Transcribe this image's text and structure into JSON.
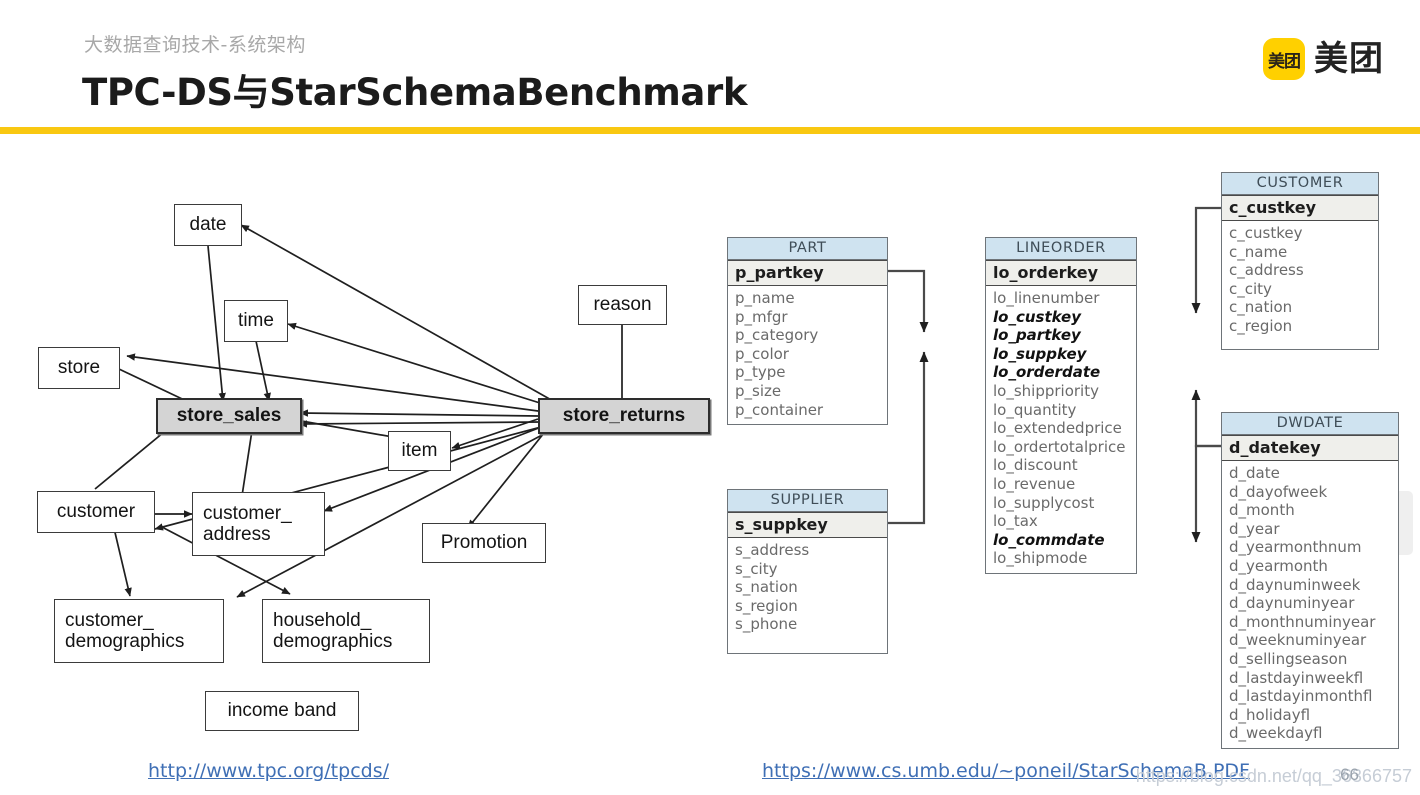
{
  "header": {
    "kicker": "大数据查询技术-系统架构",
    "title": "TPC-DS与StarSchemaBenchmark",
    "logo_badge": "美团",
    "logo_word": "美团",
    "accent_color": "#F9C811"
  },
  "tpcds_diagram": {
    "nodes": [
      {
        "id": "date",
        "label": "date"
      },
      {
        "id": "time",
        "label": "time"
      },
      {
        "id": "store",
        "label": "store"
      },
      {
        "id": "store_sales",
        "label": "store_sales"
      },
      {
        "id": "store_returns",
        "label": "store_returns"
      },
      {
        "id": "reason",
        "label": "reason"
      },
      {
        "id": "item",
        "label": "item"
      },
      {
        "id": "promotion",
        "label": "Promotion"
      },
      {
        "id": "customer",
        "label": "customer"
      },
      {
        "id": "customer_address",
        "label": "customer_\naddress"
      },
      {
        "id": "customer_demographics",
        "label": "customer_\ndemographics"
      },
      {
        "id": "household_demographics",
        "label": "household_\ndemographics"
      },
      {
        "id": "income_band",
        "label": "income band"
      }
    ],
    "fact_tables": [
      "store_sales",
      "store_returns"
    ]
  },
  "ssb_schema": {
    "tables": [
      {
        "name": "PART",
        "key": "p_partkey",
        "columns": [
          {
            "name": "p_name",
            "fk": false
          },
          {
            "name": "p_mfgr",
            "fk": false
          },
          {
            "name": "p_category",
            "fk": false
          },
          {
            "name": "p_color",
            "fk": false
          },
          {
            "name": "p_type",
            "fk": false
          },
          {
            "name": "p_size",
            "fk": false
          },
          {
            "name": "p_container",
            "fk": false
          }
        ]
      },
      {
        "name": "SUPPLIER",
        "key": "s_suppkey",
        "columns": [
          {
            "name": "s_address",
            "fk": false
          },
          {
            "name": "s_city",
            "fk": false
          },
          {
            "name": "s_nation",
            "fk": false
          },
          {
            "name": "s_region",
            "fk": false
          },
          {
            "name": "s_phone",
            "fk": false
          }
        ]
      },
      {
        "name": "LINEORDER",
        "key": "lo_orderkey",
        "columns": [
          {
            "name": "lo_linenumber",
            "fk": false
          },
          {
            "name": "lo_custkey",
            "fk": true
          },
          {
            "name": "lo_partkey",
            "fk": true
          },
          {
            "name": "lo_suppkey",
            "fk": true
          },
          {
            "name": "lo_orderdate",
            "fk": true
          },
          {
            "name": "lo_shippriority",
            "fk": false
          },
          {
            "name": "lo_quantity",
            "fk": false
          },
          {
            "name": "lo_extendedprice",
            "fk": false
          },
          {
            "name": "lo_ordertotalprice",
            "fk": false
          },
          {
            "name": "lo_discount",
            "fk": false
          },
          {
            "name": "lo_revenue",
            "fk": false
          },
          {
            "name": "lo_supplycost",
            "fk": false
          },
          {
            "name": "lo_tax",
            "fk": false
          },
          {
            "name": "lo_commdate",
            "fk": true
          },
          {
            "name": "lo_shipmode",
            "fk": false
          }
        ]
      },
      {
        "name": "CUSTOMER",
        "key": "c_custkey",
        "columns": [
          {
            "name": "c_custkey",
            "fk": false
          },
          {
            "name": "c_name",
            "fk": false
          },
          {
            "name": "c_address",
            "fk": false
          },
          {
            "name": "c_city",
            "fk": false
          },
          {
            "name": "c_nation",
            "fk": false
          },
          {
            "name": "c_region",
            "fk": false
          }
        ]
      },
      {
        "name": "DWDATE",
        "key": "d_datekey",
        "columns": [
          {
            "name": "d_date",
            "fk": false
          },
          {
            "name": "d_dayofweek",
            "fk": false
          },
          {
            "name": "d_month",
            "fk": false
          },
          {
            "name": "d_year",
            "fk": false
          },
          {
            "name": "d_yearmonthnum",
            "fk": false
          },
          {
            "name": "d_yearmonth",
            "fk": false
          },
          {
            "name": "d_daynuminweek",
            "fk": false
          },
          {
            "name": "d_daynuminyear",
            "fk": false
          },
          {
            "name": "d_monthnuminyear",
            "fk": false
          },
          {
            "name": "d_weeknuminyear",
            "fk": false
          },
          {
            "name": "d_sellingseason",
            "fk": false
          },
          {
            "name": "d_lastdayinweekfl",
            "fk": false
          },
          {
            "name": "d_lastdayinmonthfl",
            "fk": false
          },
          {
            "name": "d_holidayfl",
            "fk": false
          },
          {
            "name": "d_weekdayfl",
            "fk": false
          }
        ]
      }
    ],
    "header_color": "#cfe3f0"
  },
  "footer": {
    "link_left": "http://www.tpc.org/tpcds/",
    "link_right": "https://www.cs.umb.edu/~poneil/StarSchemaB.PDF"
  },
  "watermark": {
    "text": "https://blog.csdn.net/qq_36366757",
    "page_number": "66"
  }
}
